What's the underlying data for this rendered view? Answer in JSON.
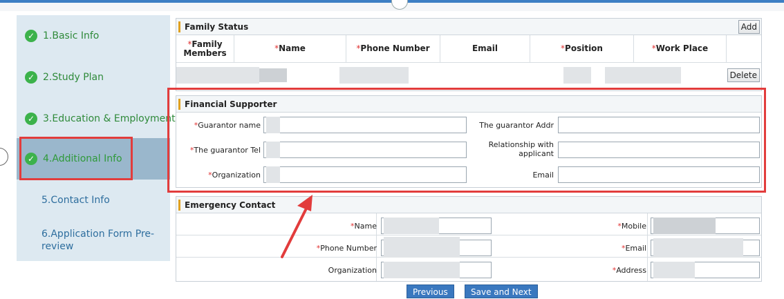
{
  "sidebar": {
    "steps": [
      {
        "label": "1.Basic Info",
        "done": true
      },
      {
        "label": "2.Study Plan",
        "done": true
      },
      {
        "label": "3.Education & Employment",
        "done": true
      },
      {
        "label": "4.Additional Info",
        "done": true,
        "active": true
      },
      {
        "label": "5.Contact Info",
        "done": false
      },
      {
        "label": "6.Application Form Pre-review",
        "done": false
      }
    ]
  },
  "family": {
    "title": "Family Status",
    "add_label": "Add",
    "delete_label": "Delete",
    "columns": [
      "Family Members",
      "Name",
      "Phone Number",
      "Email",
      "Position",
      "Work Place"
    ]
  },
  "financial": {
    "title": "Financial Supporter",
    "guarantor_name": "Guarantor name",
    "guarantor_tel": "The guarantor Tel",
    "organization": "Organization",
    "guarantor_addr": "The guarantor Addr",
    "relationship": "Relationship with applicant",
    "email": "Email"
  },
  "emergency": {
    "title": "Emergency Contact",
    "name": "Name",
    "phone": "Phone Number",
    "organization": "Organization",
    "mobile": "Mobile",
    "email": "Email",
    "address": "Address"
  },
  "buttons": {
    "previous": "Previous",
    "save_next": "Save and Next"
  },
  "colors": {
    "accent": "#3d7fc4",
    "highlight": "#e23c3c",
    "check": "#3cb24b",
    "required": "#e03030"
  }
}
